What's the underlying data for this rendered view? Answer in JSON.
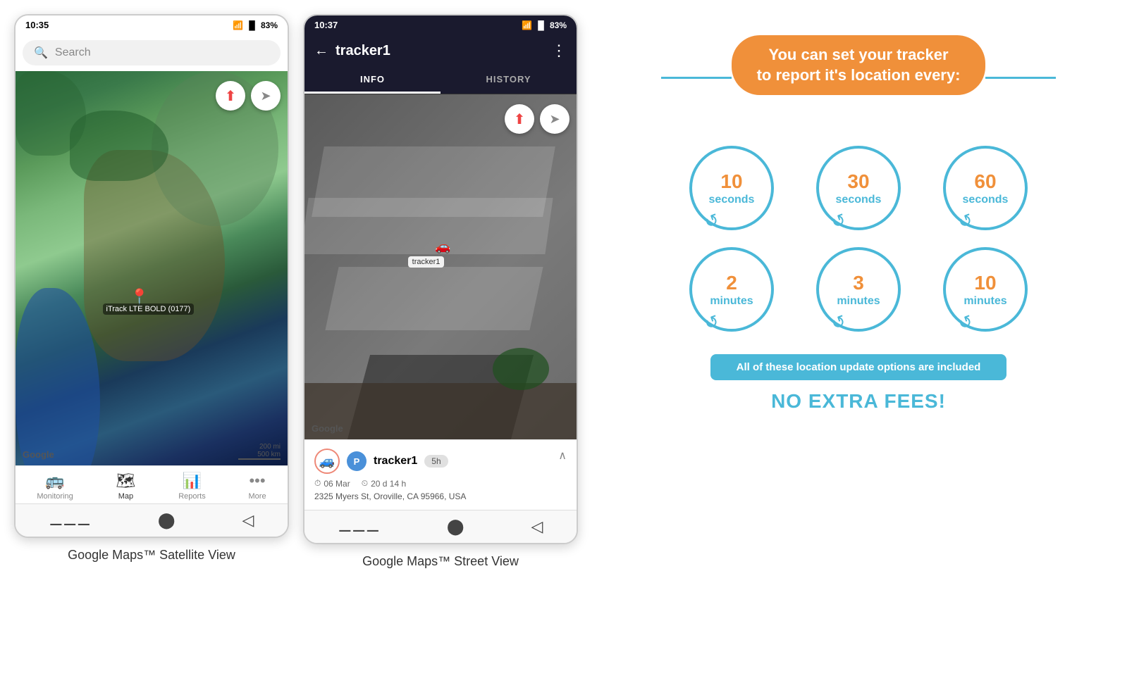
{
  "phone1": {
    "status_time": "10:35",
    "battery": "83%",
    "search_placeholder": "Search",
    "google_watermark": "Google",
    "scale_text_1": "200 mi",
    "scale_text_2": "500 km",
    "tracker_label": "iTrack LTE BOLD (0177)",
    "nav_items": [
      {
        "icon": "🚌",
        "label": "Monitoring",
        "active": false
      },
      {
        "icon": "🗺",
        "label": "Map",
        "active": true
      },
      {
        "icon": "📊",
        "label": "Reports",
        "active": false
      },
      {
        "icon": "•••",
        "label": "More",
        "active": false
      }
    ],
    "caption": "Google Maps™ Satellite View"
  },
  "phone2": {
    "status_time": "10:37",
    "battery": "83%",
    "title": "tracker1",
    "tab_info": "INFO",
    "tab_history": "HISTORY",
    "google_watermark": "Google",
    "tracker_label": "tracker1",
    "info_name": "tracker1",
    "info_date": "06 Mar",
    "info_duration": "20 d 14 h",
    "info_address": "2325 Myers St, Oroville, CA 95966, USA",
    "info_badge": "5h",
    "caption": "Google Maps™ Street View"
  },
  "infographic": {
    "title_line1": "You can set your tracker",
    "title_line2": "to report it's location every:",
    "circles": [
      {
        "number": "10",
        "unit": "seconds"
      },
      {
        "number": "30",
        "unit": "seconds"
      },
      {
        "number": "60",
        "unit": "seconds"
      },
      {
        "number": "2",
        "unit": "minutes"
      },
      {
        "number": "3",
        "unit": "minutes"
      },
      {
        "number": "10",
        "unit": "minutes"
      }
    ],
    "banner_text": "All of these location update options are included",
    "no_fees_text": "NO EXTRA FEES!",
    "accent_color": "#f0903a",
    "blue_color": "#4ab8d8"
  }
}
